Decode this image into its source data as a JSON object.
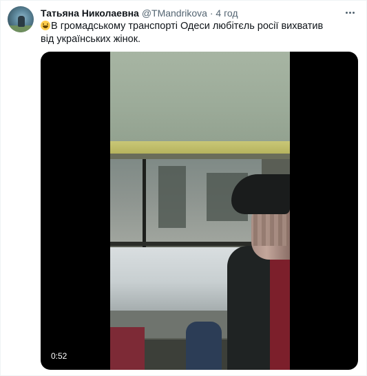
{
  "tweet": {
    "author": {
      "display_name": "Татьяна Николаевна",
      "handle": "@TMandrikova",
      "separator": " · ",
      "time": "4 год"
    },
    "emoji": "grinning-face",
    "text": "В громадському транспорті Одеси любітєль росії вихватив від українських жінок.",
    "video": {
      "duration": "0:52"
    }
  }
}
